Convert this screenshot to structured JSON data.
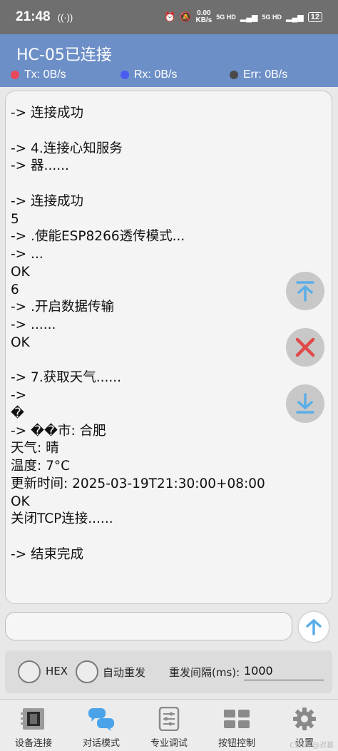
{
  "statusbar": {
    "time": "21:48",
    "speed_value": "0.00",
    "speed_unit": "KB/s",
    "sig1": "5G HD",
    "sig2": "5G HD",
    "battery": "12"
  },
  "header": {
    "title": "HC-05已连接",
    "tx": "Tx: 0B/s",
    "rx": "Rx: 0B/s",
    "err": "Err: 0B/s",
    "tx_color": "#e8485a",
    "rx_color": "#4a5cf0",
    "err_color": "#4a4a4a"
  },
  "terminal": {
    "lines": [
      "-> 连接成功",
      "",
      "-> 4.连接心知服务",
      "-> 器......",
      "",
      "-> 连接成功",
      "5",
      "-> .使能ESP8266透传模式...",
      "-> ...",
      "OK",
      "6",
      "-> .开启数据传输",
      "-> ......",
      "OK",
      "",
      "-> 7.获取天气......",
      "->",
      "�",
      "-> ��市: 合肥",
      "天气: 晴",
      "温度: 7°C",
      "更新时间: 2025-03-19T21:30:00+08:00",
      "OK",
      "关闭TCP连接......",
      "",
      "-> 结束完成"
    ]
  },
  "input": {
    "value": "",
    "placeholder": ""
  },
  "options": {
    "hex_label": "HEX",
    "auto_resend_label": "自动重发",
    "interval_label": "重发间隔(ms):",
    "interval_value": "1000"
  },
  "nav": [
    {
      "label": "设备连接",
      "icon": "device-icon"
    },
    {
      "label": "对话模式",
      "icon": "chat-icon"
    },
    {
      "label": "专业调试",
      "icon": "debug-icon"
    },
    {
      "label": "按钮控制",
      "icon": "buttons-icon"
    },
    {
      "label": "设置",
      "icon": "gear-icon"
    }
  ],
  "colors": {
    "accent": "#6d8fc7",
    "fab_blue": "#5aaee8",
    "fab_red": "#e04a4a"
  },
  "watermark": "CSDN @迟暮"
}
